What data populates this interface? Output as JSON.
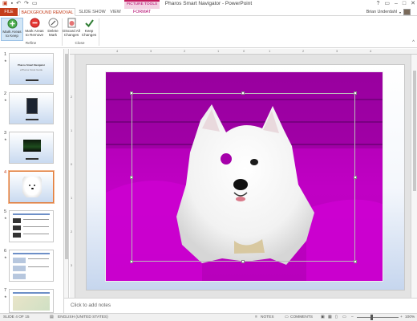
{
  "app": {
    "title": "Pharos Smart Navigator - PowerPoint",
    "qat_icons": [
      "powerpoint-logo-icon",
      "save-icon",
      "undo-icon",
      "redo-icon",
      "start-slideshow-icon"
    ]
  },
  "window_controls": [
    "?",
    "▭",
    "–",
    "□",
    "✕"
  ],
  "contextual_tab": "PICTURE TOOLS",
  "tabs": [
    "FILE",
    "BACKGROUND REMOVAL",
    "SLIDE SHOW",
    "VIEW",
    "FORMAT"
  ],
  "user": {
    "name": "Brian Underdahl"
  },
  "ribbon": {
    "keep_label_1": "Mark Areas",
    "keep_label_2": "to Keep",
    "remove_label_1": "Mark Areas",
    "remove_label_2": "to Remove",
    "delete_label_1": "Delete",
    "delete_label_2": "Mark",
    "discard_label_1": "Discard All",
    "discard_label_2": "Changes",
    "keepchg_label_1": "Keep",
    "keepchg_label_2": "Changes",
    "group_refine": "Refine",
    "group_close": "Close",
    "collapse": "^"
  },
  "thumbnails": [
    {
      "num": "1",
      "star": "★",
      "title": "Pharos Smart Navigator",
      "subtitle": "ePharos Kiosk Guide"
    },
    {
      "num": "2",
      "star": "★"
    },
    {
      "num": "3",
      "star": "★"
    },
    {
      "num": "4",
      "star": ""
    },
    {
      "num": "5",
      "star": "★"
    },
    {
      "num": "6",
      "star": "★"
    },
    {
      "num": "7",
      "star": "★"
    }
  ],
  "ruler": {
    "h": [
      "4",
      "3",
      "2",
      "1",
      "0",
      "1",
      "2",
      "3",
      "4"
    ],
    "v": [
      "2",
      "1",
      "0",
      "1",
      "2",
      "3"
    ]
  },
  "notes": {
    "placeholder": "Click to add notes"
  },
  "status": {
    "slide": "SLIDE 4 OF 15",
    "language": "ENGLISH (UNITED STATES)",
    "notes_btn": "NOTES",
    "comments_btn": "COMMENTS",
    "zoom": "100%"
  },
  "colors": {
    "accent": "#c43e1c",
    "picture_tools": "#b0006a",
    "removal_overlay": "#b000b0"
  }
}
